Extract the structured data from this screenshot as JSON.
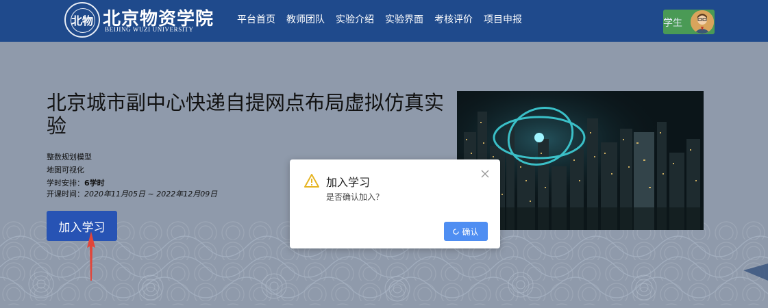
{
  "header": {
    "logo_text_cn": "北京物资学院",
    "logo_text_en": "BEIJING WUZI UNIVERSITY",
    "seal_mark": "北物",
    "nav_items": [
      "平台首页",
      "教师团队",
      "实验介绍",
      "实验界面",
      "考核评价",
      "项目申报"
    ],
    "user_role": "学生"
  },
  "course": {
    "title": "北京城市副中心快递自提网点布局虚拟仿真实验",
    "tag1": "整数规划模型",
    "tag2": "地图可视化",
    "hours_label": "学时安排：",
    "hours_value": "6学时",
    "time_label": "开课时间：",
    "time_value": "2020年11月05日 ~ 2022年12月09日",
    "join_label": "加入学习"
  },
  "modal": {
    "title": "加入学习",
    "message": "是否确认加入？",
    "confirm_label": "确认"
  },
  "colors": {
    "header": "#1f4a8c",
    "page_bg": "#8f9aab",
    "primary_button": "#2753b4",
    "confirm_button": "#4f8ef2",
    "user_chip": "#4a9a55",
    "arrow": "#e2453a",
    "warning": "#e6b422"
  }
}
